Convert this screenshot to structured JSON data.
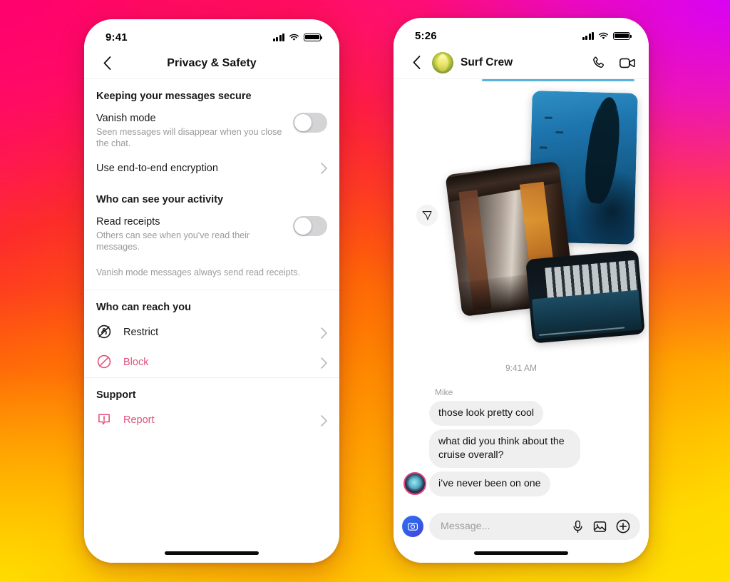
{
  "background": {
    "gradient_colors": [
      "#d600ff",
      "#ff0a6c",
      "#fd2b2b",
      "#ff5d0a",
      "#ff8a00",
      "#ffd900"
    ]
  },
  "left_phone": {
    "status_bar": {
      "time": "9:41",
      "signal_icon": "cellular-bars-icon",
      "wifi_icon": "wifi-icon",
      "battery_icon": "battery-full-icon"
    },
    "navbar": {
      "back_icon": "chevron-left-icon",
      "title": "Privacy & Safety"
    },
    "sections": [
      {
        "title": "Keeping your messages secure",
        "rows": [
          {
            "type": "toggle",
            "label": "Vanish mode",
            "sub": "Seen messages will disappear when you close the chat.",
            "toggle_state": "off"
          },
          {
            "type": "chevron",
            "label": "Use end-to-end encryption",
            "chevron_icon": "chevron-right-icon"
          }
        ]
      },
      {
        "title": "Who can see your activity",
        "rows": [
          {
            "type": "toggle",
            "label": "Read receipts",
            "sub": "Others can see when you've read their messages.",
            "toggle_state": "off"
          }
        ],
        "note": "Vanish mode messages always send read receipts."
      },
      {
        "title": "Who can reach you",
        "rows": [
          {
            "type": "icon",
            "label": "Restrict",
            "icon": "restrict-icon",
            "color": "#1a1a1a",
            "chevron_icon": "chevron-right-icon"
          },
          {
            "type": "icon",
            "label": "Block",
            "icon": "block-icon",
            "color": "#e0527a",
            "chevron_icon": "chevron-right-icon"
          }
        ]
      },
      {
        "title": "Support",
        "rows": [
          {
            "type": "icon",
            "label": "Report",
            "icon": "report-icon",
            "color": "#e0527a",
            "chevron_icon": "chevron-right-icon"
          }
        ]
      }
    ]
  },
  "right_phone": {
    "status_bar": {
      "time": "5:26",
      "signal_icon": "cellular-bars-icon",
      "wifi_icon": "wifi-icon",
      "battery_icon": "battery-full-icon"
    },
    "chat_header": {
      "back_icon": "chevron-left-icon",
      "avatar": "group-avatar",
      "name": "Surf Crew",
      "call_icon": "phone-call-icon",
      "video_icon": "video-camera-icon"
    },
    "collage": {
      "share_icon": "share-paper-plane-icon",
      "photos": [
        {
          "name": "underwater-freediver-photo"
        },
        {
          "name": "ship-hallway-photo"
        },
        {
          "name": "indoor-pool-photo"
        }
      ]
    },
    "timestamp": "9:41 AM",
    "conversation": {
      "sender": "Mike",
      "messages": [
        "those look pretty cool",
        "what did you think about the cruise overall?",
        "i’ve never been on one"
      ]
    },
    "input_bar": {
      "camera_icon": "camera-icon",
      "placeholder": "Message...",
      "mic_icon": "microphone-icon",
      "gallery_icon": "photo-gallery-icon",
      "plus_icon": "plus-circle-icon"
    }
  }
}
